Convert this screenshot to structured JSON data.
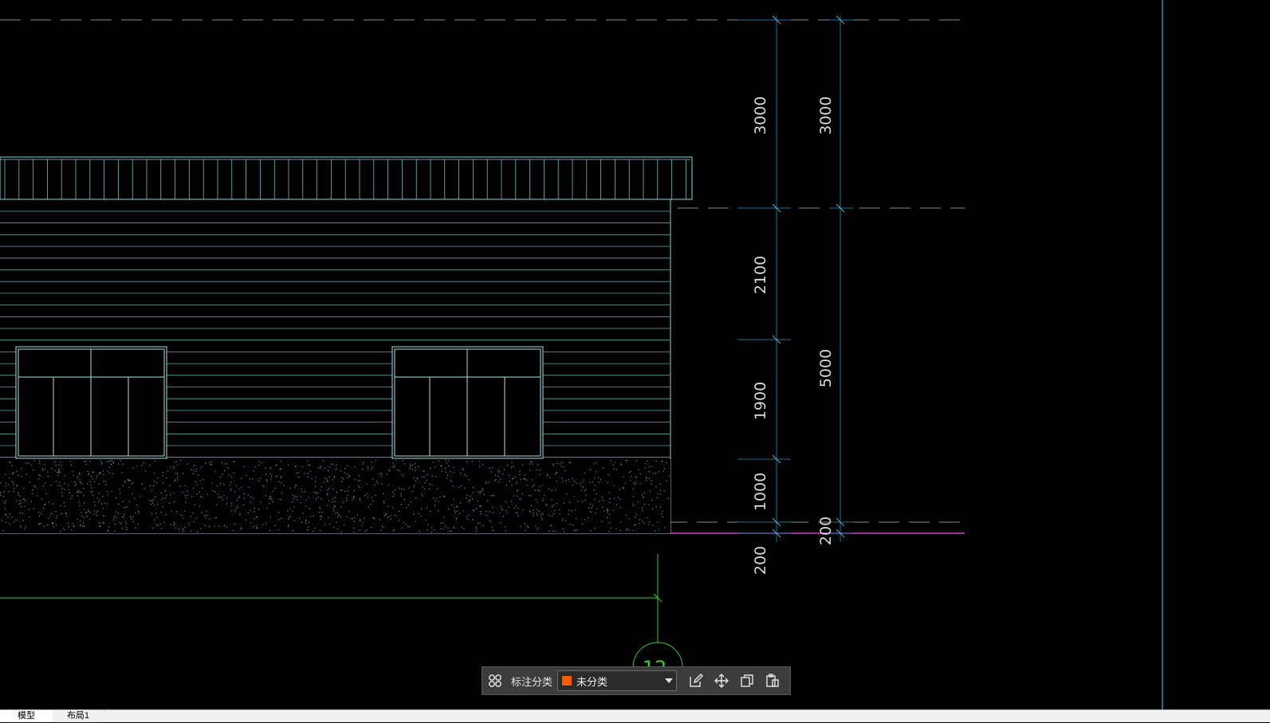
{
  "drawing": {
    "horizontal_dimensions": [
      "3000",
      "2100",
      "1900",
      "1000",
      "200"
    ],
    "total_dimensions": [
      "3000",
      "5000",
      "200"
    ],
    "axis_label": "12"
  },
  "dimension_toolbar": {
    "label": "标注分类",
    "selected_category": "未分类",
    "category_color": "#ff5a00",
    "icons": [
      "grid-layout-icon",
      "edit-icon",
      "move-icon",
      "copy-icon",
      "paste-icon"
    ]
  },
  "layout_tabs": [
    {
      "label": "模型",
      "active": true
    },
    {
      "label": "布局1",
      "active": false
    }
  ],
  "colors": {
    "background": "#000000",
    "building_lines": "#7fd6d6",
    "dimension_lines": "#1f6f8f",
    "ground_line": "#d63cd6",
    "axis_line": "#33cc33"
  }
}
